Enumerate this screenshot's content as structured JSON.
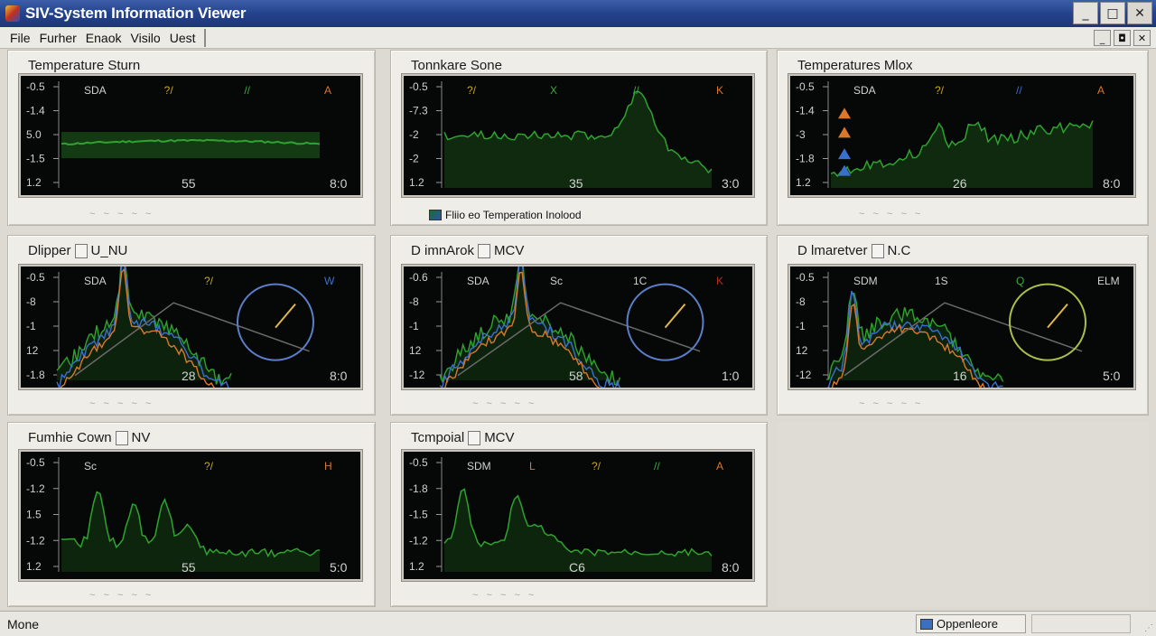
{
  "window": {
    "title": "SIV-System Information Viewer",
    "minimize": "_",
    "maximize": "□",
    "close": "✕"
  },
  "menu": {
    "items": [
      "File",
      "Furher",
      "Enaok",
      "Visilo",
      "Uest"
    ]
  },
  "mdi": {
    "minimize": "_",
    "restore": "◘",
    "close": "✕"
  },
  "panels": [
    {
      "title": "Temperature Sturn",
      "box": "",
      "yticks": [
        "-0.5",
        "-1.4",
        "5.0",
        "-1.5",
        "1.2"
      ],
      "top_labels": [
        {
          "t": "SDA",
          "c": "#cfd2cf"
        },
        {
          "t": "?/",
          "c": "#c9a623"
        },
        {
          "t": "//",
          "c": "#3fa83f"
        },
        {
          "t": "A",
          "c": "#d9782a"
        }
      ],
      "x_mid": "55",
      "x_end": "8:0",
      "footer": "~ ~ ~ ~ ~"
    },
    {
      "title": "Tonnkare Sone",
      "box": "",
      "yticks": [
        "-0.5",
        "-7.3",
        "-2",
        "-2",
        "1.2"
      ],
      "top_labels": [
        {
          "t": "?/",
          "c": "#c9a623"
        },
        {
          "t": "X",
          "c": "#3fa83f"
        },
        {
          "t": "//",
          "c": "#3fa83f"
        },
        {
          "t": "K",
          "c": "#d9782a"
        }
      ],
      "x_mid": "35",
      "x_end": "3:0",
      "legend": "Fliio eo Temperation Inolood"
    },
    {
      "title": "Temperatures Mlox",
      "box": "",
      "yticks": [
        "-0.5",
        "-1.4",
        "-3",
        "-1.8",
        "1.2"
      ],
      "top_labels": [
        {
          "t": "SDA",
          "c": "#cfd2cf"
        },
        {
          "t": "?/",
          "c": "#c9a623"
        },
        {
          "t": "//",
          "c": "#3a6fd0"
        },
        {
          "t": "A",
          "c": "#d9782a"
        }
      ],
      "x_mid": "26",
      "x_end": "8:0",
      "footer": "~ ~ ~ ~ ~"
    },
    {
      "title": "Dlipper",
      "box": "U_NU",
      "yticks": [
        "-0.5",
        "-8",
        "-1",
        "12",
        "-1.8"
      ],
      "top_labels": [
        {
          "t": "SDA",
          "c": "#cfd2cf"
        },
        {
          "t": "?/",
          "c": "#c9a623"
        },
        {
          "t": "W",
          "c": "#3a6fd0"
        }
      ],
      "x_mid": "28",
      "x_end": "8:0",
      "footer": "~ ~ ~ ~ ~"
    },
    {
      "title": "D imnArok",
      "box": "MCV",
      "yticks": [
        "-0.6",
        "-8",
        "-1",
        "12",
        "-12"
      ],
      "top_labels": [
        {
          "t": "SDA",
          "c": "#cfd2cf"
        },
        {
          "t": "Sc",
          "c": "#cfd2cf"
        },
        {
          "t": "1C",
          "c": "#cfd2cf"
        },
        {
          "t": "K",
          "c": "#b03020"
        }
      ],
      "x_mid": "58",
      "x_end": "1:0",
      "footer": "~ ~ ~ ~ ~"
    },
    {
      "title": "D lmaretver",
      "box": "N.C",
      "yticks": [
        "-0.5",
        "-8",
        "-1",
        "12",
        "-12"
      ],
      "top_labels": [
        {
          "t": "SDM",
          "c": "#cfd2cf"
        },
        {
          "t": "1S",
          "c": "#cfd2cf"
        },
        {
          "t": "Q",
          "c": "#3fa83f"
        },
        {
          "t": "ELM",
          "c": "#cfd2cf"
        }
      ],
      "x_mid": "16",
      "x_end": "5:0",
      "footer": "~ ~ ~ ~ ~"
    },
    {
      "title": "Fumhie Cown",
      "box": "NV",
      "yticks": [
        "-0.5",
        "-1.2",
        "1.5",
        "-1.2",
        "1.2"
      ],
      "top_labels": [
        {
          "t": "Sc",
          "c": "#cfd2cf"
        },
        {
          "t": "?/",
          "c": "#c9a623"
        },
        {
          "t": "H",
          "c": "#d9782a"
        }
      ],
      "x_mid": "55",
      "x_end": "5:0",
      "footer": "~ ~ ~ ~ ~"
    },
    {
      "title": "Tcmpoial",
      "box": "MCV",
      "yticks": [
        "-0.5",
        "-1.8",
        "-1.5",
        "-1.2",
        "1.2"
      ],
      "top_labels": [
        {
          "t": "SDM",
          "c": "#cfd2cf"
        },
        {
          "t": "L",
          "c": "#d9782a"
        },
        {
          "t": "?/",
          "c": "#c9a623"
        },
        {
          "t": "//",
          "c": "#3fa83f"
        },
        {
          "t": "A",
          "c": "#d9782a"
        }
      ],
      "x_mid": "C6",
      "x_end": "8:0",
      "footer": "~ ~ ~ ~ ~"
    }
  ],
  "status": {
    "text": "Mone",
    "pane": "Oppenleore"
  },
  "colors": {
    "green": "#2fa32f",
    "orange": "#d9782a",
    "blue": "#3a6fd0",
    "gray": "#6a6a6a",
    "plot_bg": "#050807"
  }
}
